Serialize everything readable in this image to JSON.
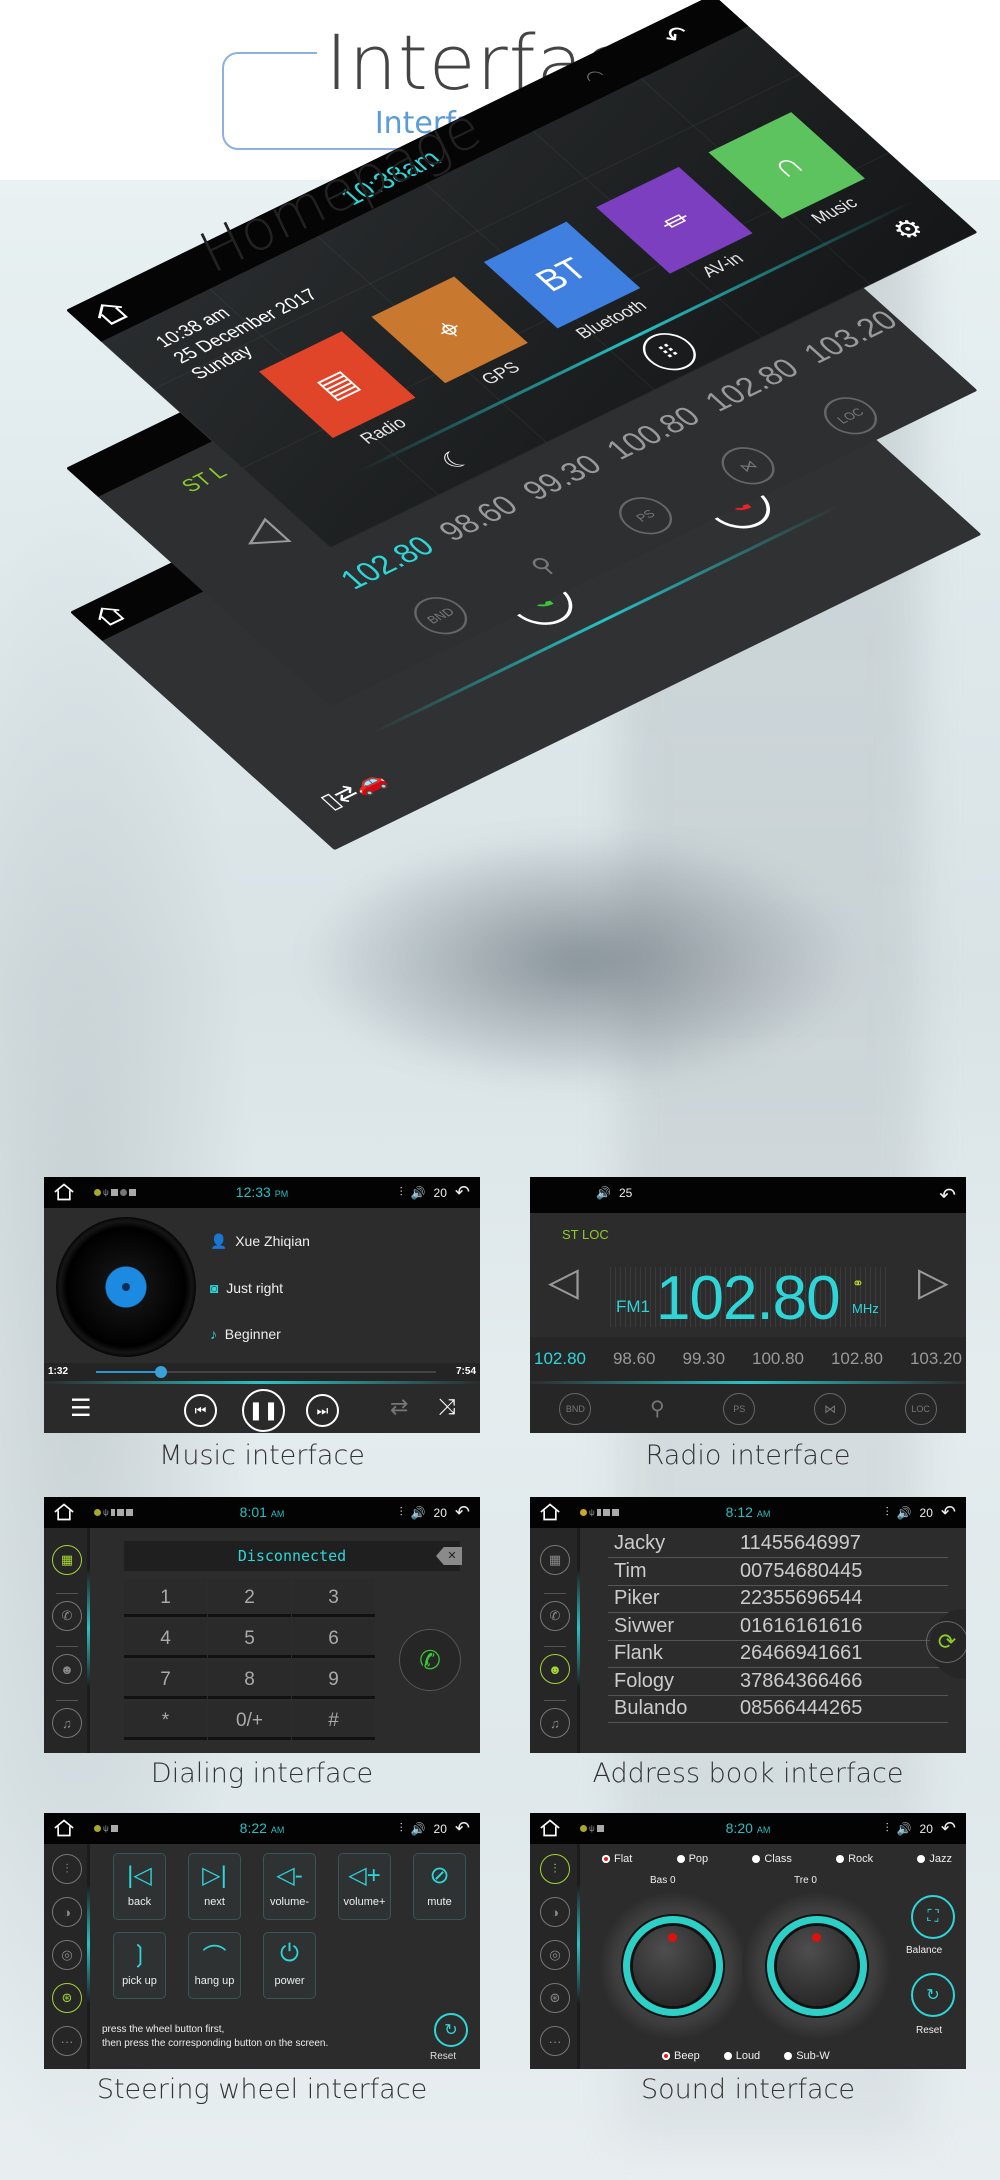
{
  "header": {
    "title": "Interface",
    "subtitle": "Interface display"
  },
  "homepage": {
    "label": "Homepage",
    "clock": "10:38am",
    "date_lines": [
      "10:38 am",
      "25 December 2017",
      "Sunday"
    ],
    "apps": [
      {
        "label": "Radio",
        "icon": "radio-icon",
        "color": "#e0452a"
      },
      {
        "label": "GPS",
        "icon": "location-pin-icon",
        "color": "#c9782f"
      },
      {
        "label": "Bluetooth",
        "icon": "bluetooth-icon",
        "glyph": "BT",
        "color": "#3e7fe0"
      },
      {
        "label": "AV-in",
        "icon": "av-plug-icon",
        "color": "#7b3fc0"
      },
      {
        "label": "Music",
        "icon": "music-icon",
        "color": "#5cc35f"
      }
    ],
    "radio_layer": {
      "status": "ST L",
      "frequencies": [
        "102.80",
        "98.60",
        "99.30",
        "100.80",
        "102.80",
        "103.20"
      ],
      "buttons": [
        "BND",
        "search",
        "PS",
        "stereo",
        "LOC"
      ]
    }
  },
  "music": {
    "caption": "Music interface",
    "clock": "12:33",
    "clock_suffix": "PM",
    "volume": "20",
    "artist": "Xue Zhiqian",
    "album": "Just right",
    "song": "Beginner",
    "elapsed": "1:32",
    "total": "7:54",
    "progress": 0.19
  },
  "radio": {
    "caption": "Radio interface",
    "volume": "25",
    "status": "ST  LOC",
    "band": "FM1",
    "frequency": "102.80",
    "unit": "MHz",
    "presets": [
      "102.80",
      "98.60",
      "99.30",
      "100.80",
      "102.80",
      "103.20"
    ],
    "active_preset": 0,
    "buttons": [
      "BND",
      "search",
      "PS",
      "stereo",
      "LOC"
    ]
  },
  "dialing": {
    "caption": "Dialing interface",
    "clock": "8:01",
    "clock_suffix": "AM",
    "volume": "20",
    "status": "Disconnected",
    "keys": [
      "1",
      "2",
      "3",
      "4",
      "5",
      "6",
      "7",
      "8",
      "9",
      "*",
      "0/+",
      "#"
    ]
  },
  "address_book": {
    "caption": "Address book interface",
    "clock": "8:12",
    "clock_suffix": "AM",
    "volume": "20",
    "contacts": [
      {
        "name": "Jacky",
        "phone": "11455646997"
      },
      {
        "name": "Tim",
        "phone": "00754680445"
      },
      {
        "name": "Piker",
        "phone": "22355696544"
      },
      {
        "name": "Sivwer",
        "phone": "01616161616"
      },
      {
        "name": "Flank",
        "phone": "26466941661"
      },
      {
        "name": "Fology",
        "phone": "37864366466"
      },
      {
        "name": "Bulando",
        "phone": "08566444265"
      }
    ]
  },
  "steering": {
    "caption": "Steering wheel interface",
    "clock": "8:22",
    "clock_suffix": "AM",
    "volume": "20",
    "buttons": [
      "back",
      "next",
      "volume-",
      "volume+",
      "mute",
      "pick up",
      "hang up",
      "power"
    ],
    "hint_line1": "press the wheel button first,",
    "hint_line2": "then press the corresponding button on the screen.",
    "reset": "Reset"
  },
  "sound": {
    "caption": "Sound interface",
    "clock": "8:20",
    "clock_suffix": "AM",
    "volume": "20",
    "presets": [
      "Flat",
      "Pop",
      "Class",
      "Rock",
      "Jazz"
    ],
    "selected_preset": "Flat",
    "bass_label": "Bas 0",
    "treble_label": "Tre 0",
    "toggles": [
      "Beep",
      "Loud",
      "Sub-W"
    ],
    "selected_toggle": "Beep",
    "balance": "Balance",
    "reset": "Reset"
  },
  "colors": {
    "accent": "#2fd6d8",
    "active": "#a3d630",
    "panel": "#2c2c2d"
  }
}
